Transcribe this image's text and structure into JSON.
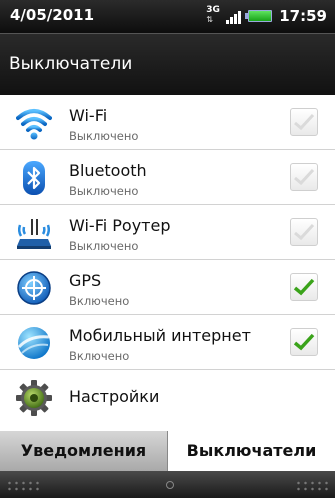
{
  "status_bar": {
    "date": "4/05/2011",
    "network": "3G",
    "time": "17:59"
  },
  "header": {
    "title": "Выключатели"
  },
  "items": [
    {
      "title": "Wi-Fi",
      "status": "Выключено",
      "checked": false,
      "icon": "wifi-icon"
    },
    {
      "title": "Bluetooth",
      "status": "Выключено",
      "checked": false,
      "icon": "bluetooth-icon"
    },
    {
      "title": "Wi-Fi Роутер",
      "status": "Выключено",
      "checked": false,
      "icon": "wifi-router-icon"
    },
    {
      "title": "GPS",
      "status": "Включено",
      "checked": true,
      "icon": "gps-icon"
    },
    {
      "title": "Мобильный интернет",
      "status": "Включено",
      "checked": true,
      "icon": "mobile-internet-icon"
    }
  ],
  "settings": {
    "title": "Настройки",
    "icon": "gear-icon"
  },
  "tabs": [
    {
      "label": "Уведомления",
      "active": false
    },
    {
      "label": "Выключатели",
      "active": true
    }
  ],
  "colors": {
    "check": "#3aa31a",
    "wifi_blue": "#1c8ee0",
    "gear_green": "#5a8a1e"
  }
}
